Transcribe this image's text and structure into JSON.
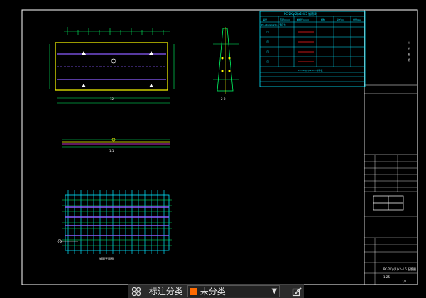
{
  "colors": {
    "frame": "#ffffff",
    "cyan": "#00e5ff",
    "yellow": "#ffff00",
    "green": "#00ff66",
    "magenta": "#ff40ff",
    "red": "#ff2020",
    "category": "#ff6a00"
  },
  "drawing": {
    "top_plan": {
      "dim_label": "12"
    },
    "section_label": "2-2",
    "side_view_label": "1:1",
    "table": {
      "title": "PC-2Kg(2)x2-4.5 钢筋表",
      "headers": [
        "编号",
        "直径(mm)",
        "单根长(mm)",
        "根数",
        "总长(m)",
        "重量(kg)"
      ],
      "first_row": [
        "PC-2Kg(2)x2-4.5 预应力",
        "",
        "",
        "",
        "",
        ""
      ],
      "row_ids": [
        "①",
        "②",
        "③",
        "④"
      ],
      "sub_title": "PC-2Kg(2)x2-4.5 材料表"
    },
    "title_block": {
      "vertical_text": [
        "人",
        "方",
        "图",
        "纸"
      ],
      "drawing_no": "PC-2Kg(2)x2-4.5 配筋图",
      "scale": "1:25",
      "sheet": "1/1"
    },
    "lower_plan_label": "钢筋平面图"
  },
  "toolbar": {
    "icon": "annotation-category-icon",
    "label": "标注分类",
    "category_value": "未分类",
    "dropdown_icon": "chevron-down-icon",
    "edit_icon": "edit-icon"
  }
}
